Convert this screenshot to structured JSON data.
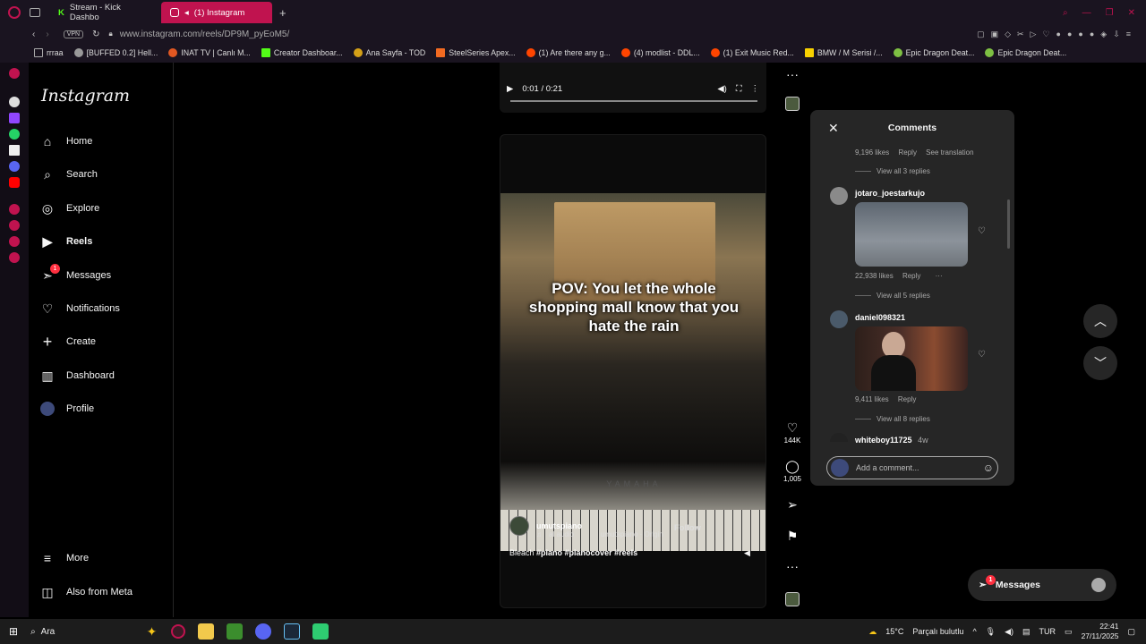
{
  "browser": {
    "tabs": [
      {
        "label": "Stream - Kick Dashbo",
        "active": false
      },
      {
        "label": "(1) Instagram",
        "active": true
      }
    ],
    "vpn_label": "VPN",
    "url": "www.instagram.com/reels/DP9M_pyEoM5/",
    "bookmarks": [
      "rrraa",
      "[BUFFED 0.2] Hell...",
      "INAT TV | Canlı M...",
      "Creator Dashboar...",
      "Ana Sayfa - TOD",
      "SteelSeries Apex...",
      "(1) Are there any g...",
      "(4) modlist - DDL...",
      "(1) Exit Music Red...",
      "BMW / M Serisi /...",
      "Epic Dragon Deat...",
      "Epic Dragon Deat..."
    ],
    "accent": "#c0134f"
  },
  "sidebar": {
    "logo": "Instagram",
    "items": [
      {
        "label": "Home",
        "icon": "home-icon",
        "glyph": "⌂"
      },
      {
        "label": "Search",
        "icon": "search-icon",
        "glyph": "⌕"
      },
      {
        "label": "Explore",
        "icon": "compass-icon",
        "glyph": "◎"
      },
      {
        "label": "Reels",
        "icon": "reels-icon",
        "glyph": "▶"
      },
      {
        "label": "Messages",
        "icon": "messenger-icon",
        "glyph": "➣",
        "badge": "1"
      },
      {
        "label": "Notifications",
        "icon": "heart-icon",
        "glyph": "♡"
      },
      {
        "label": "Create",
        "icon": "plus-icon",
        "glyph": "+"
      },
      {
        "label": "Dashboard",
        "icon": "chart-icon",
        "glyph": "▥"
      },
      {
        "label": "Profile",
        "icon": "avatar-icon",
        "glyph": "●"
      }
    ],
    "more": "More",
    "also_from_meta": "Also from Meta"
  },
  "prev_reel": {
    "time": "0:01 / 0:21"
  },
  "reel": {
    "overlay_text": "POV: You let the whole shopping mall know that you hate the rain",
    "brand": "YAMAHA",
    "author": "umutspiano",
    "audio_label": "al audio",
    "audio_source": "umutspiano · Origin",
    "follow": "Follow",
    "description_prefix": "Bleach",
    "hashtags": "#piano #pianocover #reels",
    "likes": "144K",
    "comments": "1,005"
  },
  "comments_panel": {
    "title": "Comments",
    "top_meta": {
      "likes": "9,196 likes",
      "reply": "Reply",
      "translate": "See translation"
    },
    "view_replies_1": "View all 3 replies",
    "items": [
      {
        "user": "jotaro_joestarkujo",
        "likes": "22,938 likes",
        "reply": "Reply",
        "more": "···",
        "replies": "View all 5 replies"
      },
      {
        "user": "daniel098321",
        "likes": "9,411 likes",
        "reply": "Reply",
        "replies": "View all 8 replies"
      },
      {
        "user": "whiteboy11725",
        "time": "4w"
      }
    ],
    "input_placeholder": "Add a comment..."
  },
  "messages_pill": {
    "label": "Messages",
    "badge": "1"
  },
  "taskbar": {
    "search": "Ara",
    "weather_temp": "15°C",
    "weather_desc": "Parçalı bulutlu",
    "lang": "TUR",
    "time": "22:41",
    "date": "27/11/2025"
  }
}
